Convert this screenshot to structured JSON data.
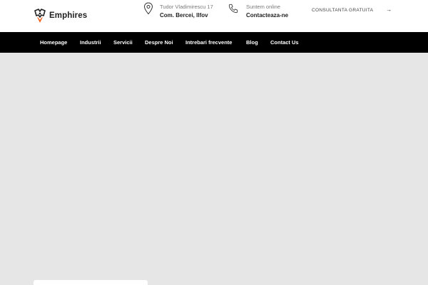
{
  "brand": {
    "name": "Emphires",
    "icon": "emphires-logo-icon",
    "accent": "#f26522"
  },
  "contact": {
    "address": {
      "icon": "map-pin-icon",
      "line1": "Tudor Vladimirescu 17",
      "line2": "Com. Bercei, Ilfov"
    },
    "phone": {
      "icon": "phone-icon",
      "line1": "Suntem online",
      "line2": "Contacteaza-ne"
    }
  },
  "cta": {
    "label": "CONSULTANTA GRATUITA",
    "icon": "arrow-right-icon",
    "arrow": "→"
  },
  "nav": {
    "items": [
      {
        "label": "Homepage"
      },
      {
        "label": "Industrii"
      },
      {
        "label": "Servicii"
      },
      {
        "label": "Despre Noi"
      },
      {
        "label": "Intrebari frecvente"
      },
      {
        "label": "Blog"
      },
      {
        "label": "Contact Us"
      }
    ]
  },
  "colors": {
    "topbar": "#ffffff",
    "navbar": "#000000",
    "hero": "#e6e6e6"
  }
}
